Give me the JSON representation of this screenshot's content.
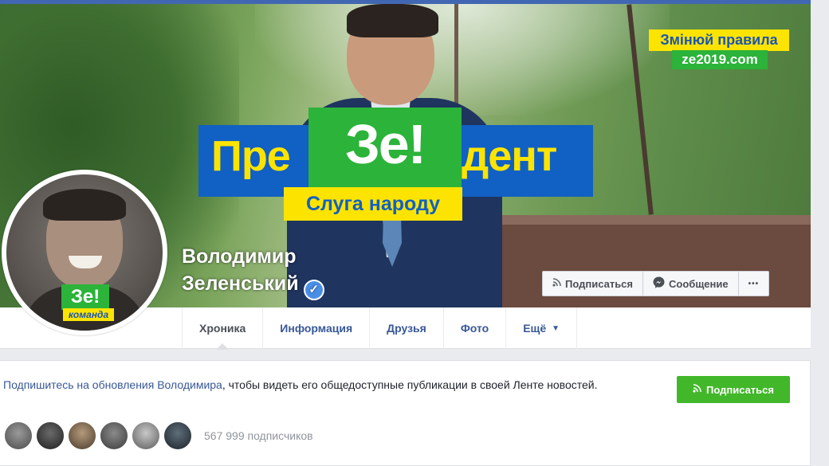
{
  "cover": {
    "slogan_pre": "Пре",
    "slogan_ze": "Зе!",
    "slogan_dent": "дент",
    "slogan_sub": "Слуга народу",
    "rules_text": "Змінюй правила",
    "site_text": "ze2019.com"
  },
  "profile": {
    "name_line1": "Володимир",
    "name_line2": "Зеленський",
    "verified_mark": "✓",
    "badge_ze": "Зе!",
    "badge_team": "команда"
  },
  "cover_actions": {
    "follow_label": "Подписаться",
    "message_label": "Сообщение",
    "more_label": "•••"
  },
  "tabs": [
    {
      "label": "Хроника",
      "active": true
    },
    {
      "label": "Информация",
      "active": false
    },
    {
      "label": "Друзья",
      "active": false
    },
    {
      "label": "Фото",
      "active": false
    },
    {
      "label": "Ещё",
      "active": false
    }
  ],
  "follow_card": {
    "link_text": "Подпишитесь на обновления Володимира",
    "rest_text": ", чтобы видеть его общедоступные публикации в своей Ленте новостей.",
    "button_label": "Подписаться",
    "followers_count": "567 999 подписчиков"
  },
  "colors": {
    "fb_blue": "#4267b2",
    "link_blue": "#385898",
    "follow_green": "#42b72a",
    "campaign_blue": "#1160c4",
    "campaign_yellow": "#fde400",
    "campaign_green": "#2bb33a"
  },
  "icons": {
    "rss": "rss-icon",
    "messenger": "messenger-icon",
    "caret": "chevron-down-icon",
    "verified": "verified-badge-icon"
  }
}
